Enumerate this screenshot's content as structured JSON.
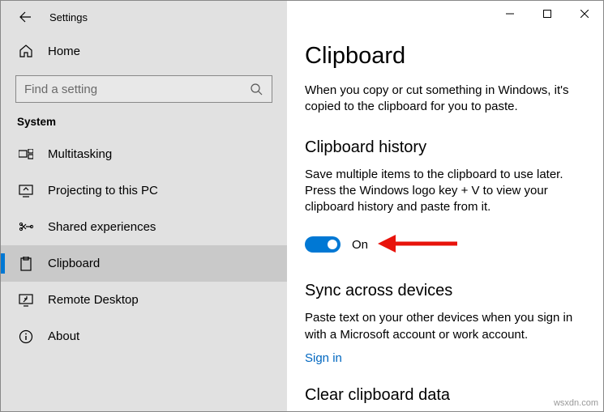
{
  "window": {
    "title": "Settings"
  },
  "sidebar": {
    "home_label": "Home",
    "search_placeholder": "Find a setting",
    "group_title": "System",
    "items": [
      {
        "label": "Multitasking"
      },
      {
        "label": "Projecting to this PC"
      },
      {
        "label": "Shared experiences"
      },
      {
        "label": "Clipboard"
      },
      {
        "label": "Remote Desktop"
      },
      {
        "label": "About"
      }
    ]
  },
  "content": {
    "page_title": "Clipboard",
    "intro": "When you copy or cut something in Windows, it's copied to the clipboard for you to paste.",
    "history": {
      "heading": "Clipboard history",
      "desc": "Save multiple items to the clipboard to use later. Press the Windows logo key + V to view your clipboard history and paste from it.",
      "toggle_state": "On"
    },
    "sync": {
      "heading": "Sync across devices",
      "desc": "Paste text on your other devices when you sign in with a Microsoft account or work account.",
      "link": "Sign in"
    },
    "clear": {
      "heading": "Clear clipboard data"
    }
  },
  "watermark": "wsxdn.com"
}
